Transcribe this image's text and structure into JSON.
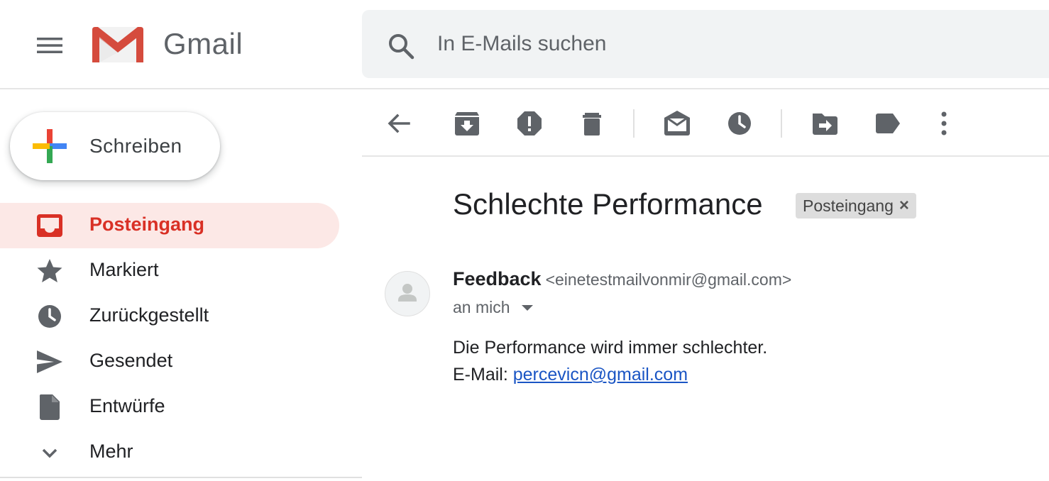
{
  "header": {
    "brand": "Gmail",
    "search": {
      "placeholder": "In E-Mails suchen",
      "value": "",
      "icon": "search-icon"
    },
    "menu_icon": "hamburger-icon"
  },
  "compose": {
    "label": "Schreiben",
    "icon": "compose-plus-icon"
  },
  "sidebar": {
    "items": [
      {
        "label": "Posteingang",
        "icon": "inbox-icon",
        "active": true
      },
      {
        "label": "Markiert",
        "icon": "star-icon",
        "active": false
      },
      {
        "label": "Zurückgestellt",
        "icon": "clock-icon",
        "active": false
      },
      {
        "label": "Gesendet",
        "icon": "send-icon",
        "active": false
      },
      {
        "label": "Entwürfe",
        "icon": "draft-icon",
        "active": false
      },
      {
        "label": "Mehr",
        "icon": "chevron-down-icon",
        "active": false
      }
    ]
  },
  "toolbar": {
    "icons": [
      "back-arrow-icon",
      "archive-icon",
      "report-spam-icon",
      "delete-icon",
      "mark-unread-icon",
      "snooze-icon",
      "move-to-icon",
      "label-icon",
      "more-vert-icon"
    ]
  },
  "message": {
    "subject": "Schlechte Performance",
    "label_chip": "Posteingang",
    "label_remove": "×",
    "sender_name": "Feedback",
    "sender_email": "<einetestmailvonmir@gmail.com>",
    "recipient": "an mich",
    "body_line1": "Die Performance wird immer schlechter.",
    "body_line2_prefix": "E-Mail: ",
    "body_link": "percevicn@gmail.com"
  },
  "colors": {
    "accent_red": "#d93025",
    "active_bg": "#fce8e6",
    "link": "#1a55c4",
    "icon_gray": "#5f6368",
    "search_bg": "#f1f3f4"
  }
}
